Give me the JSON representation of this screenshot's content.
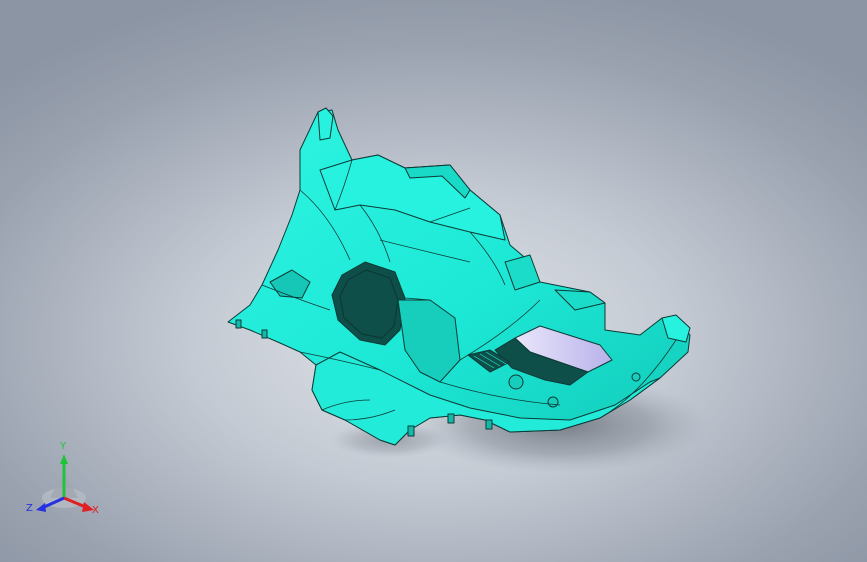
{
  "viewport": {
    "model_color": "#1de8d6",
    "edge_color": "#0c3a36",
    "shadow_color": "#7c828c",
    "glass_color": "#c9c3ef"
  },
  "triad": {
    "y_label": "Y",
    "z_label": "Z",
    "x_label": "X",
    "y_color": "#22c23a",
    "x_color": "#e02020",
    "z_color": "#2530e0",
    "icon": "coordinate-triad-icon"
  }
}
